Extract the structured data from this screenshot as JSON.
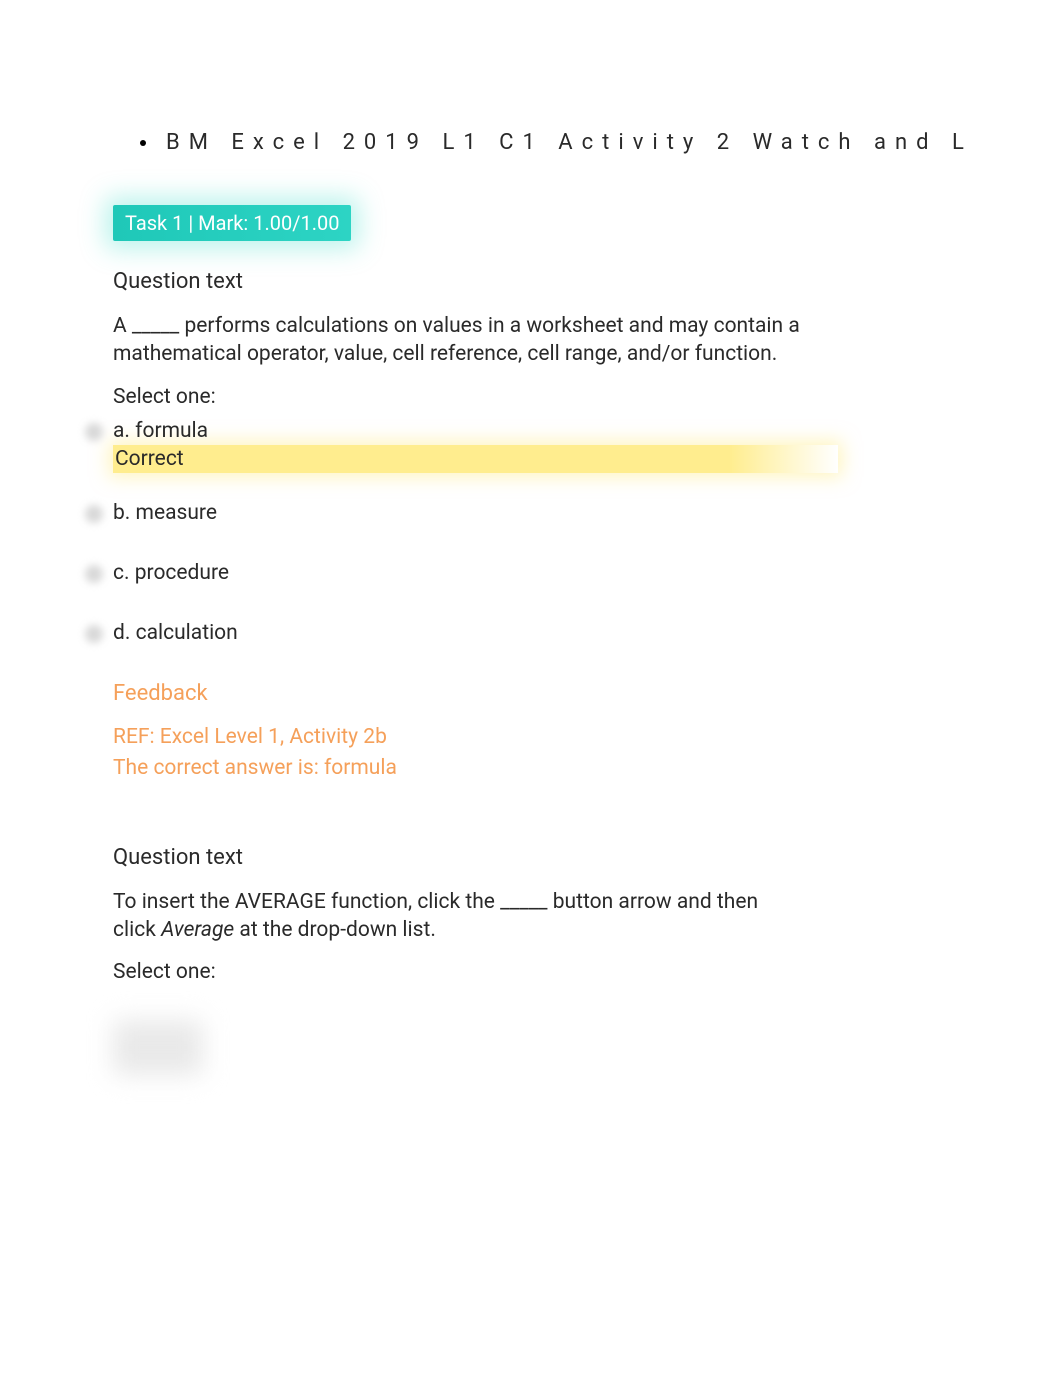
{
  "breadcrumb": {
    "title": "BM Excel 2019 L1 C1 Activity 2 Watch and L"
  },
  "task_badge": "Task 1 | Mark: 1.00/1.00",
  "q1": {
    "heading": "Question text",
    "body": "A _____ performs calculations on values in a worksheet and may contain a mathematical operator, value, cell reference, cell range, and/or function.",
    "select_one": "Select one:",
    "options": {
      "a": "a. formula",
      "b": "b. measure",
      "c": "c. procedure",
      "d": "d. calculation"
    },
    "correct_label": "Correct",
    "feedback_heading": "Feedback",
    "feedback_ref": "REF: Excel Level 1, Activity 2b",
    "feedback_answer": "The correct answer is: formula"
  },
  "q2": {
    "heading": "Question text",
    "body_pre": "To insert the AVERAGE function, click the _____ button arrow and then click ",
    "body_italic": "Average",
    "body_post": " at the drop-down list.",
    "select_one": "Select one:"
  }
}
